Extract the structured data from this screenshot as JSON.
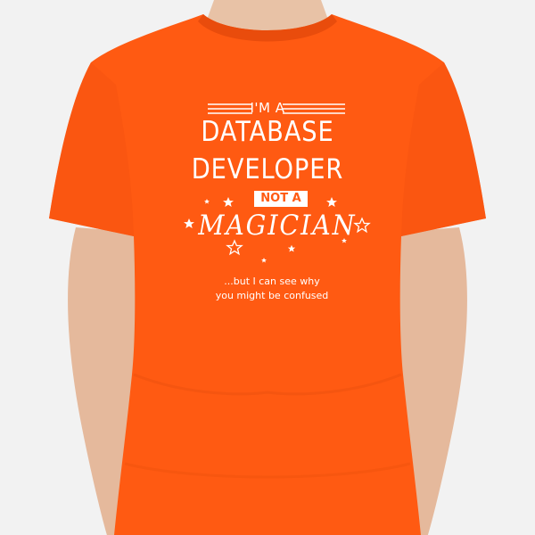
{
  "shirt": {
    "color": "#ff5a12",
    "ink_color": "#ffffff",
    "design": {
      "intro": "I'M A",
      "role_line1": "DATABASE",
      "role_line2": "DEVELOPER",
      "badge": "NOT A",
      "magician": "MAGICIAN",
      "tagline_line1": "...but I can see why",
      "tagline_line2": "you might be confused"
    },
    "decorations": [
      "star-icon",
      "double-rule"
    ]
  }
}
